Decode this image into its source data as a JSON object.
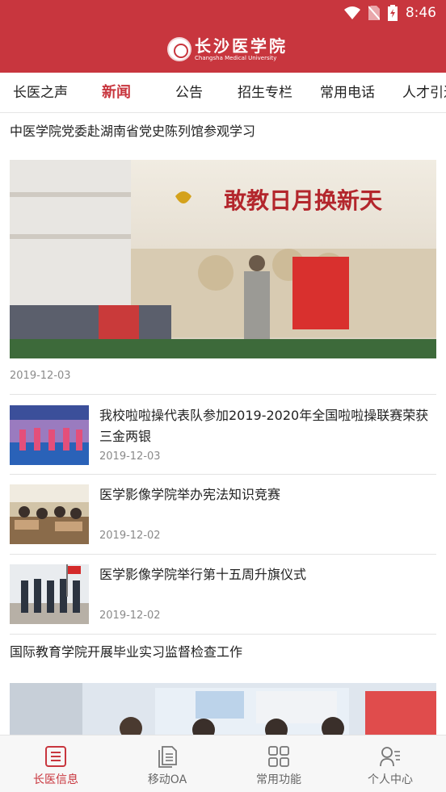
{
  "status_bar": {
    "time": "8:46"
  },
  "header": {
    "logo_cn": "长沙医学院",
    "logo_en": "Changsha Medical University"
  },
  "tabs": [
    {
      "label": "长医之声"
    },
    {
      "label": "新闻"
    },
    {
      "label": "公告"
    },
    {
      "label": "招生专栏"
    },
    {
      "label": "常用电话"
    },
    {
      "label": "人才引进"
    }
  ],
  "active_tab": "新闻",
  "feed": {
    "featured": [
      {
        "title": "中医学院党委赴湖南省党史陈列馆参观学习",
        "date": "2019-12-03",
        "image_text": "敢教日月换新天"
      },
      {
        "title": "国际教育学院开展毕业实习监督检查工作"
      }
    ],
    "items": [
      {
        "title": "我校啦啦操代表队参加2019-2020年全国啦啦操联赛荣获三金两银",
        "date": "2019-12-03"
      },
      {
        "title": "医学影像学院举办宪法知识竞赛",
        "date": "2019-12-02"
      },
      {
        "title": "医学影像学院举行第十五周升旗仪式",
        "date": "2019-12-02"
      }
    ]
  },
  "bottom_nav": [
    {
      "label": "长医信息",
      "icon": "list-icon"
    },
    {
      "label": "移动OA",
      "icon": "document-icon"
    },
    {
      "label": "常用功能",
      "icon": "grid-icon"
    },
    {
      "label": "个人中心",
      "icon": "person-icon"
    }
  ],
  "colors": {
    "brand": "#c8363e",
    "date": "#8a8a8a",
    "divider": "#e3e3e3"
  }
}
